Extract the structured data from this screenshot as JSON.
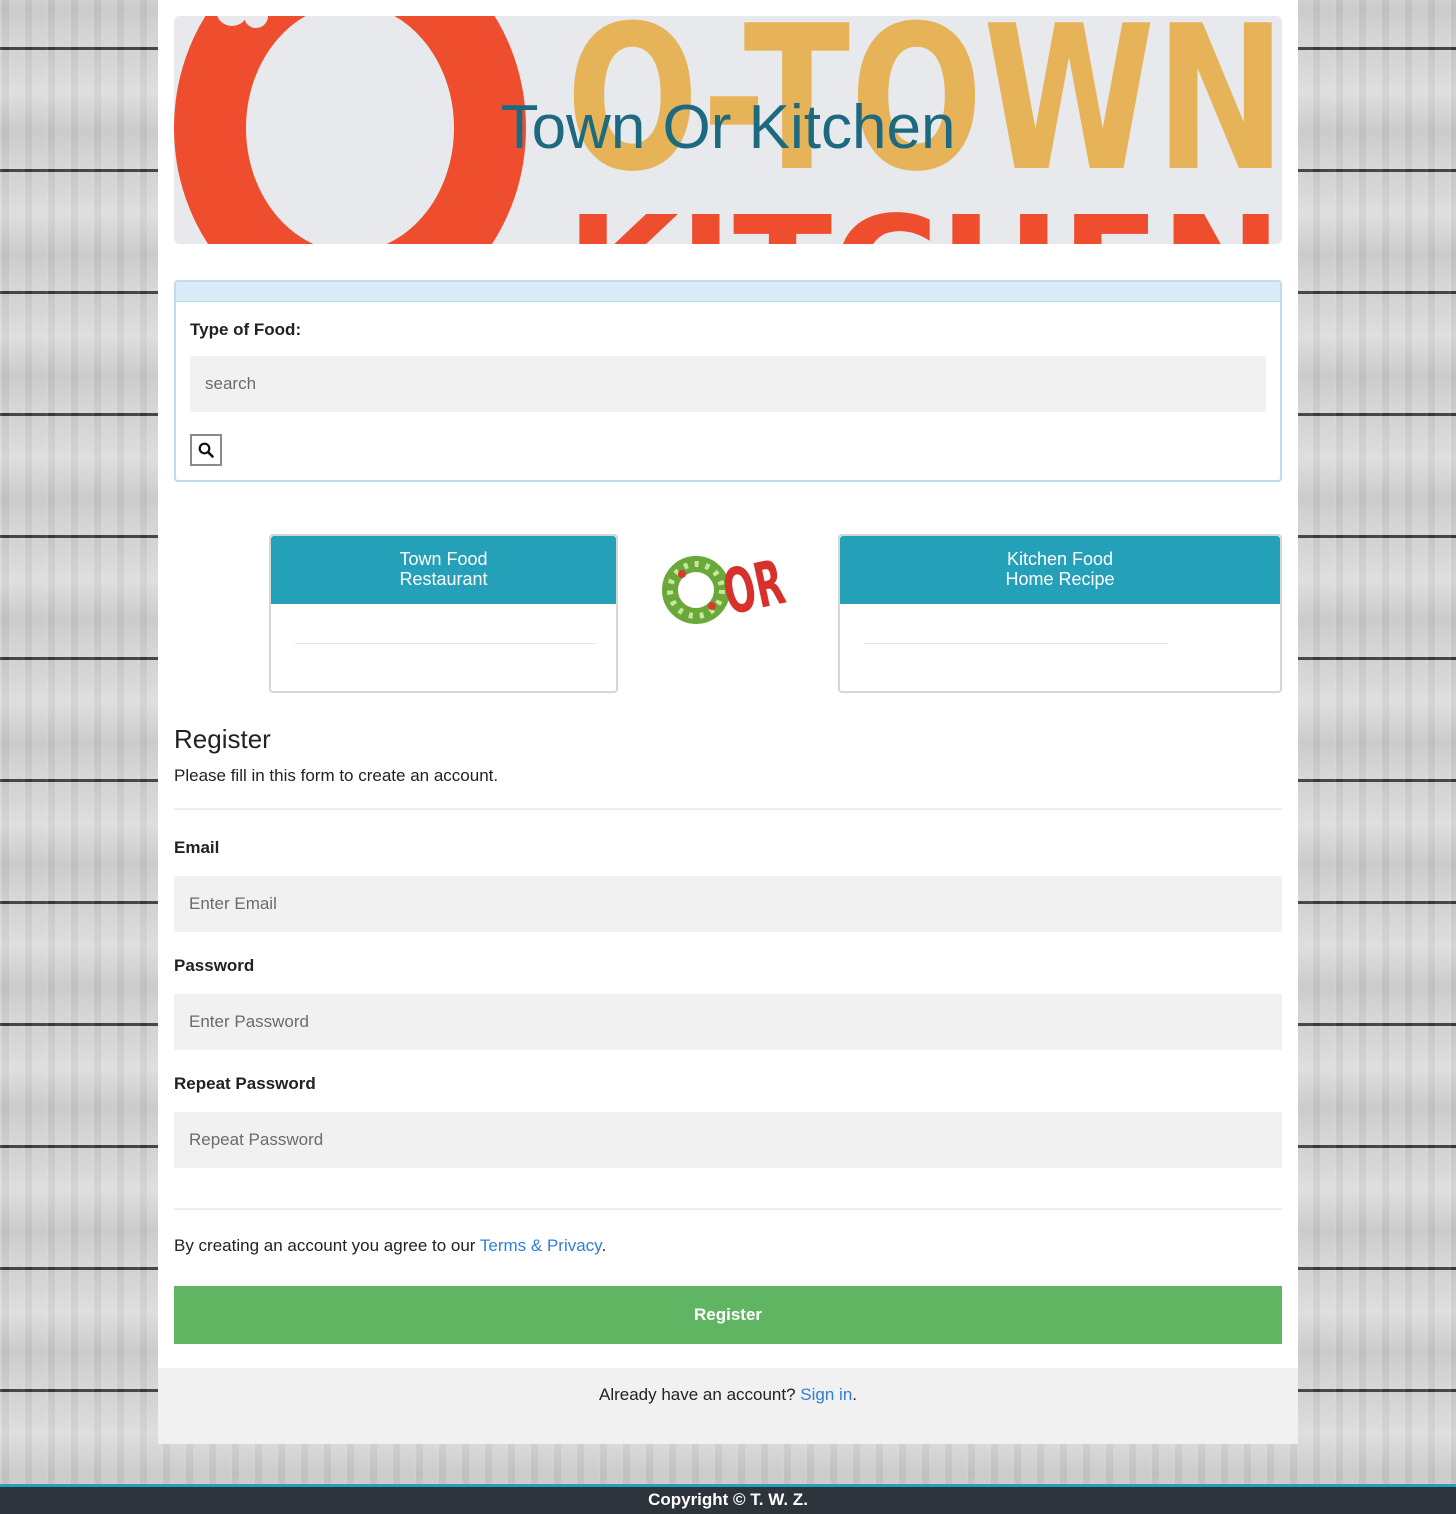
{
  "banner": {
    "title": "Town Or Kitchen",
    "logo_text_top": "O-TOWN",
    "logo_text_bottom": "KITCHEN"
  },
  "search": {
    "label": "Type of Food:",
    "placeholder": "search",
    "button_icon": "search-icon"
  },
  "choices": {
    "left": {
      "line1": "Town Food",
      "line2": "Restaurant"
    },
    "or_logo_text": "OR",
    "right": {
      "line1": "Kitchen Food",
      "line2": "Home Recipe"
    }
  },
  "register": {
    "title": "Register",
    "subtitle": "Please fill in this form to create an account.",
    "email_label": "Email",
    "email_placeholder": "Enter Email",
    "password_label": "Password",
    "password_placeholder": "Enter Password",
    "repeat_label": "Repeat Password",
    "repeat_placeholder": "Repeat Password",
    "terms_prefix": "By creating an account you agree to our ",
    "terms_link": "Terms & Privacy",
    "terms_suffix": ".",
    "button_label": "Register",
    "signin_prefix": "Already have an account? ",
    "signin_link": "Sign in",
    "signin_suffix": "."
  },
  "footer": {
    "copyright": "Copyright © T. W. Z."
  },
  "colors": {
    "accent": "#24a0b9",
    "title": "#1d6a80",
    "register_button": "#5fb562",
    "link": "#2d7fd8",
    "footer_bg": "#2e343b"
  }
}
